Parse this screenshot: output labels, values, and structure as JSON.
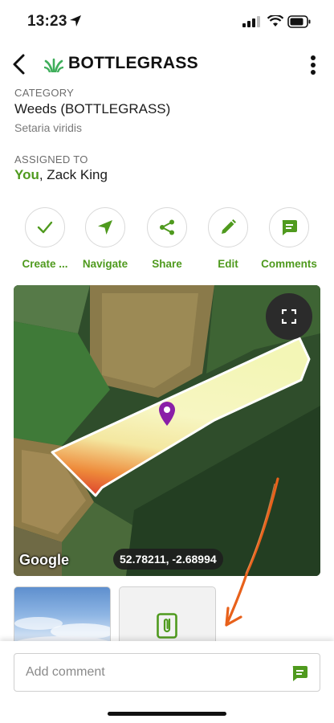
{
  "status_bar": {
    "time": "13:23",
    "icons": [
      "location-arrow-icon",
      "signal-icon",
      "wifi-icon",
      "battery-icon"
    ]
  },
  "header": {
    "title": "BOTTLEGRASS",
    "icon": "grass-icon",
    "back_icon": "chevron-left-icon",
    "more_icon": "vertical-dots-icon"
  },
  "details": {
    "category_label": "CATEGORY",
    "category_value": "Weeds (BOTTLEGRASS)",
    "category_sub": "Setaria viridis",
    "assigned_label": "ASSIGNED TO",
    "assigned_you": "You",
    "assigned_rest": ", Zack King"
  },
  "actions": [
    {
      "label": "Create ...",
      "icon": "check-icon"
    },
    {
      "label": "Navigate",
      "icon": "navigation-arrow-icon"
    },
    {
      "label": "Share",
      "icon": "share-icon"
    },
    {
      "label": "Edit",
      "icon": "pencil-icon"
    },
    {
      "label": "Comments",
      "icon": "comment-icon"
    }
  ],
  "map": {
    "attribution": "Google",
    "coordinates": "52.78211, -2.68994",
    "fullscreen_icon": "fullscreen-icon",
    "pin_icon": "map-pin-icon"
  },
  "attachments": [
    {
      "type": "photo",
      "icon": "sky-photo"
    },
    {
      "type": "file",
      "icon": "paperclip-icon"
    }
  ],
  "comment": {
    "placeholder": "Add comment",
    "send_icon": "comment-send-icon"
  },
  "colors": {
    "accent": "#4f9a1e",
    "annotation_arrow": "#e8611b",
    "pin": "#8a1fa8"
  }
}
